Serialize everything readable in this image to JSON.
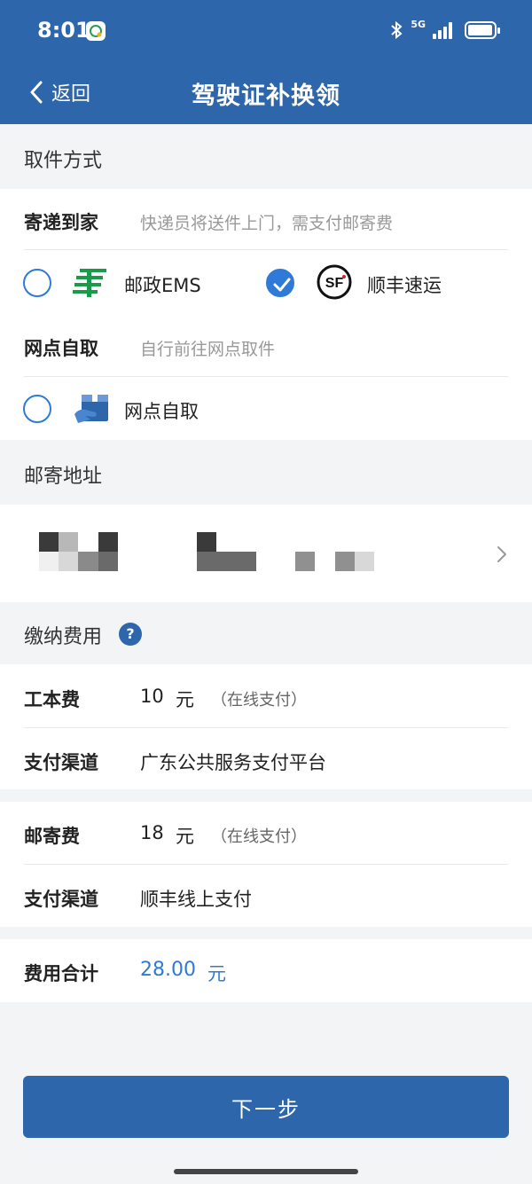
{
  "status": {
    "time": "8:01",
    "network": "5G"
  },
  "nav": {
    "back_label": "返回",
    "title": "驾驶证补换领"
  },
  "pickup": {
    "section_title": "取件方式",
    "mail_label": "寄递到家",
    "mail_hint": "快递员将送件上门，需支付邮寄费",
    "ems_label": "邮政EMS",
    "sf_label": "顺丰速运",
    "selected": "顺丰速运",
    "self_label": "网点自取",
    "self_hint": "自行前往网点取件",
    "self_option_label": "网点自取"
  },
  "address": {
    "section_title": "邮寄地址"
  },
  "fees": {
    "section_title": "缴纳费用",
    "cost_label": "工本费",
    "cost_amount": "10",
    "cost_unit": "元",
    "cost_note": "（在线支付）",
    "channel_label_1": "支付渠道",
    "channel_value_1": "广东公共服务支付平台",
    "postage_label": "邮寄费",
    "postage_amount": "18",
    "postage_unit": "元",
    "postage_note": "（在线支付）",
    "channel_label_2": "支付渠道",
    "channel_value_2": "顺丰线上支付",
    "total_label": "费用合计",
    "total_amount": "28.00",
    "total_unit": "元"
  },
  "actions": {
    "next_label": "下一步"
  },
  "colors": {
    "primary": "#2e66ac",
    "accent": "#2e7ad6",
    "ems_green": "#1a9a4a"
  }
}
